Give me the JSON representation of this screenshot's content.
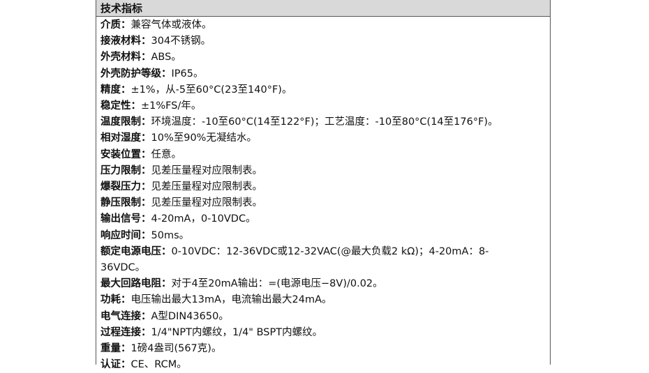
{
  "header": {
    "title": "技术指标"
  },
  "rows": [
    {
      "label": "介质：",
      "value": "兼容气体或液体。"
    },
    {
      "label": "接液材料：",
      "value": "304不锈钢。"
    },
    {
      "label": "外壳材料：",
      "value": "ABS。"
    },
    {
      "label": "外壳防护等级：",
      "value": "IP65。"
    },
    {
      "label": "精度：",
      "value": "±1%，从-5至60°C(23至140°F)。"
    },
    {
      "label": "稳定性：",
      "value": "±1%FS/年。"
    },
    {
      "label": "温度限制：",
      "value": "环境温度：-10至60°C(14至122°F)；工艺温度：-10至80°C(14至176°F)。"
    },
    {
      "label": "相对湿度：",
      "value": "10%至90%无凝结水。"
    },
    {
      "label": "安装位置：",
      "value": "任意。"
    },
    {
      "label": "压力限制：",
      "value": "见差压量程对应限制表。"
    },
    {
      "label": "爆裂压力：",
      "value": "见差压量程对应限制表。"
    },
    {
      "label": "静压限制：",
      "value": "见差压量程对应限制表。"
    },
    {
      "label": "输出信号：",
      "value": "4-20mA，0-10VDC。"
    },
    {
      "label": "响应时间：",
      "value": "50ms。"
    },
    {
      "label": "额定电源电压：",
      "value": "0-10VDC：12-36VDC或12-32VAC(@最大负载2 kΩ)；4-20mA：8-36VDC。"
    },
    {
      "label": "最大回路电阻：",
      "value": "对于4至20mA输出：=(电源电压−8V)/0.02。"
    },
    {
      "label": "功耗：",
      "value": "电压输出最大13mA，电流输出最大24mA。"
    },
    {
      "label": "电气连接：",
      "value": "A型DIN43650。"
    },
    {
      "label": "过程连接：",
      "value": "1/4\"NPT内螺纹，1/4\" BSPT内螺纹。"
    },
    {
      "label": "重量：",
      "value": "1磅4盎司(567克)。"
    },
    {
      "label": "认证：",
      "value": "CE、RCM。"
    }
  ]
}
